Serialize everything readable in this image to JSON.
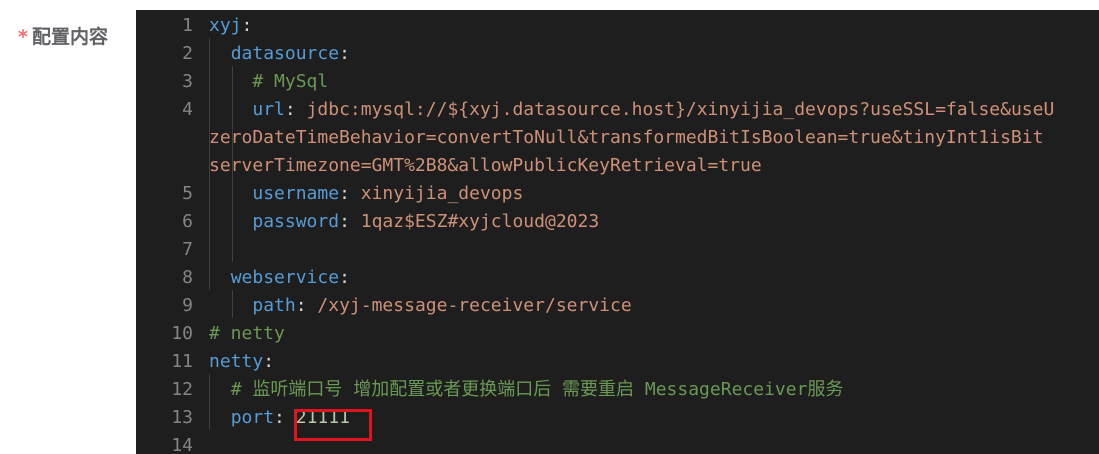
{
  "form": {
    "required_mark": "*",
    "label": "配置内容"
  },
  "editor": {
    "lines": [
      {
        "n": "1",
        "segs": [
          [
            "key",
            "xyj"
          ],
          [
            "punc",
            ":"
          ]
        ]
      },
      {
        "n": "2",
        "segs": [
          [
            "punc",
            "  "
          ],
          [
            "key",
            "datasource"
          ],
          [
            "punc",
            ":"
          ]
        ]
      },
      {
        "n": "3",
        "segs": [
          [
            "punc",
            "    "
          ],
          [
            "cmt",
            "# MySql"
          ]
        ]
      },
      {
        "n": "4",
        "segs": [
          [
            "punc",
            "    "
          ],
          [
            "key",
            "url"
          ],
          [
            "punc",
            ": "
          ],
          [
            "val",
            "jdbc:mysql://${xyj.datasource.host}/xinyijia_devops?useSSL=false&useU"
          ]
        ]
      },
      {
        "n": "",
        "segs": [
          [
            "val",
            "zeroDateTimeBehavior=convertToNull&transformedBitIsBoolean=true&tinyInt1isBit"
          ]
        ]
      },
      {
        "n": "",
        "segs": [
          [
            "val",
            "serverTimezone=GMT%2B8&allowPublicKeyRetrieval=true"
          ]
        ]
      },
      {
        "n": "5",
        "segs": [
          [
            "punc",
            "    "
          ],
          [
            "key",
            "username"
          ],
          [
            "punc",
            ": "
          ],
          [
            "val",
            "xinyijia_devops"
          ]
        ]
      },
      {
        "n": "6",
        "segs": [
          [
            "punc",
            "    "
          ],
          [
            "key",
            "password"
          ],
          [
            "punc",
            ": "
          ],
          [
            "val",
            "1qaz$ESZ#xyjcloud@2023"
          ]
        ]
      },
      {
        "n": "7",
        "segs": []
      },
      {
        "n": "8",
        "segs": [
          [
            "punc",
            "  "
          ],
          [
            "key",
            "webservice"
          ],
          [
            "punc",
            ":"
          ]
        ]
      },
      {
        "n": "9",
        "segs": [
          [
            "punc",
            "    "
          ],
          [
            "key",
            "path"
          ],
          [
            "punc",
            ": "
          ],
          [
            "val",
            "/xyj-message-receiver/service"
          ]
        ]
      },
      {
        "n": "10",
        "segs": [
          [
            "cmt",
            "# netty"
          ]
        ]
      },
      {
        "n": "11",
        "segs": [
          [
            "key",
            "netty"
          ],
          [
            "punc",
            ":"
          ]
        ]
      },
      {
        "n": "12",
        "segs": [
          [
            "punc",
            "  "
          ],
          [
            "cmt",
            "# 监听端口号 增加配置或者更换端口后 需要重启 MessageReceiver服务"
          ]
        ]
      },
      {
        "n": "13",
        "segs": [
          [
            "punc",
            "  "
          ],
          [
            "key",
            "port"
          ],
          [
            "punc",
            ": "
          ],
          [
            "num",
            "21111"
          ]
        ]
      },
      {
        "n": "14",
        "segs": []
      }
    ]
  }
}
